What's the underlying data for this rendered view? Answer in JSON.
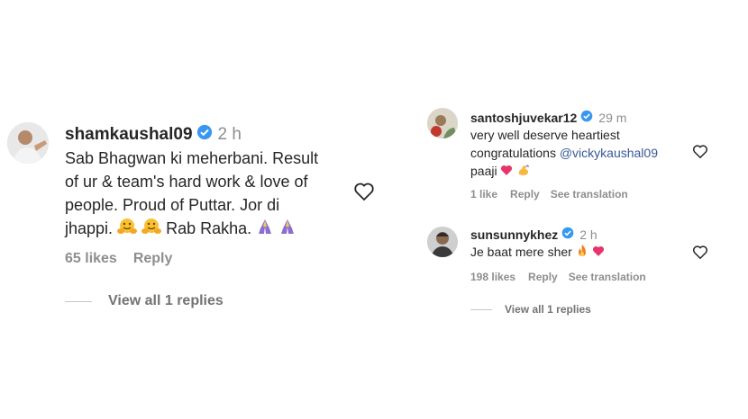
{
  "left_comment": {
    "username": "shamkaushal09",
    "time": "2 h",
    "lines": [
      "Sab Bhagwan ki meherbani. Result",
      "of ur & team's hard work & love of",
      "people. Proud of Puttar. Jor di",
      "jhappi."
    ],
    "tail_text": "Rab Rakha.",
    "likes": "65 likes",
    "reply_label": "Reply",
    "view_replies": "View all 1 replies",
    "icons": [
      "avatar",
      "verified-badge-icon",
      "hugging-face-emoji",
      "folded-hands-emoji",
      "heart-outline-icon"
    ]
  },
  "right_comments": [
    {
      "username": "santoshjuvekar12",
      "time": "29 m",
      "line1": "very well deserve heartiest",
      "line2_prefix": "congratulations ",
      "mention": "@vickykaushal09",
      "line3": "paaji",
      "likes": "1 like",
      "reply_label": "Reply",
      "see_translation": "See translation"
    },
    {
      "username": "sunsunnykhez",
      "time": "2 h",
      "text": "Je baat mere sher",
      "likes": "198 likes",
      "reply_label": "Reply",
      "see_translation": "See translation",
      "view_replies": "View all 1 replies"
    }
  ],
  "colors": {
    "verified": "#3897f0",
    "mention": "#385898",
    "muted": "#8e8e8e",
    "text": "#262626"
  }
}
